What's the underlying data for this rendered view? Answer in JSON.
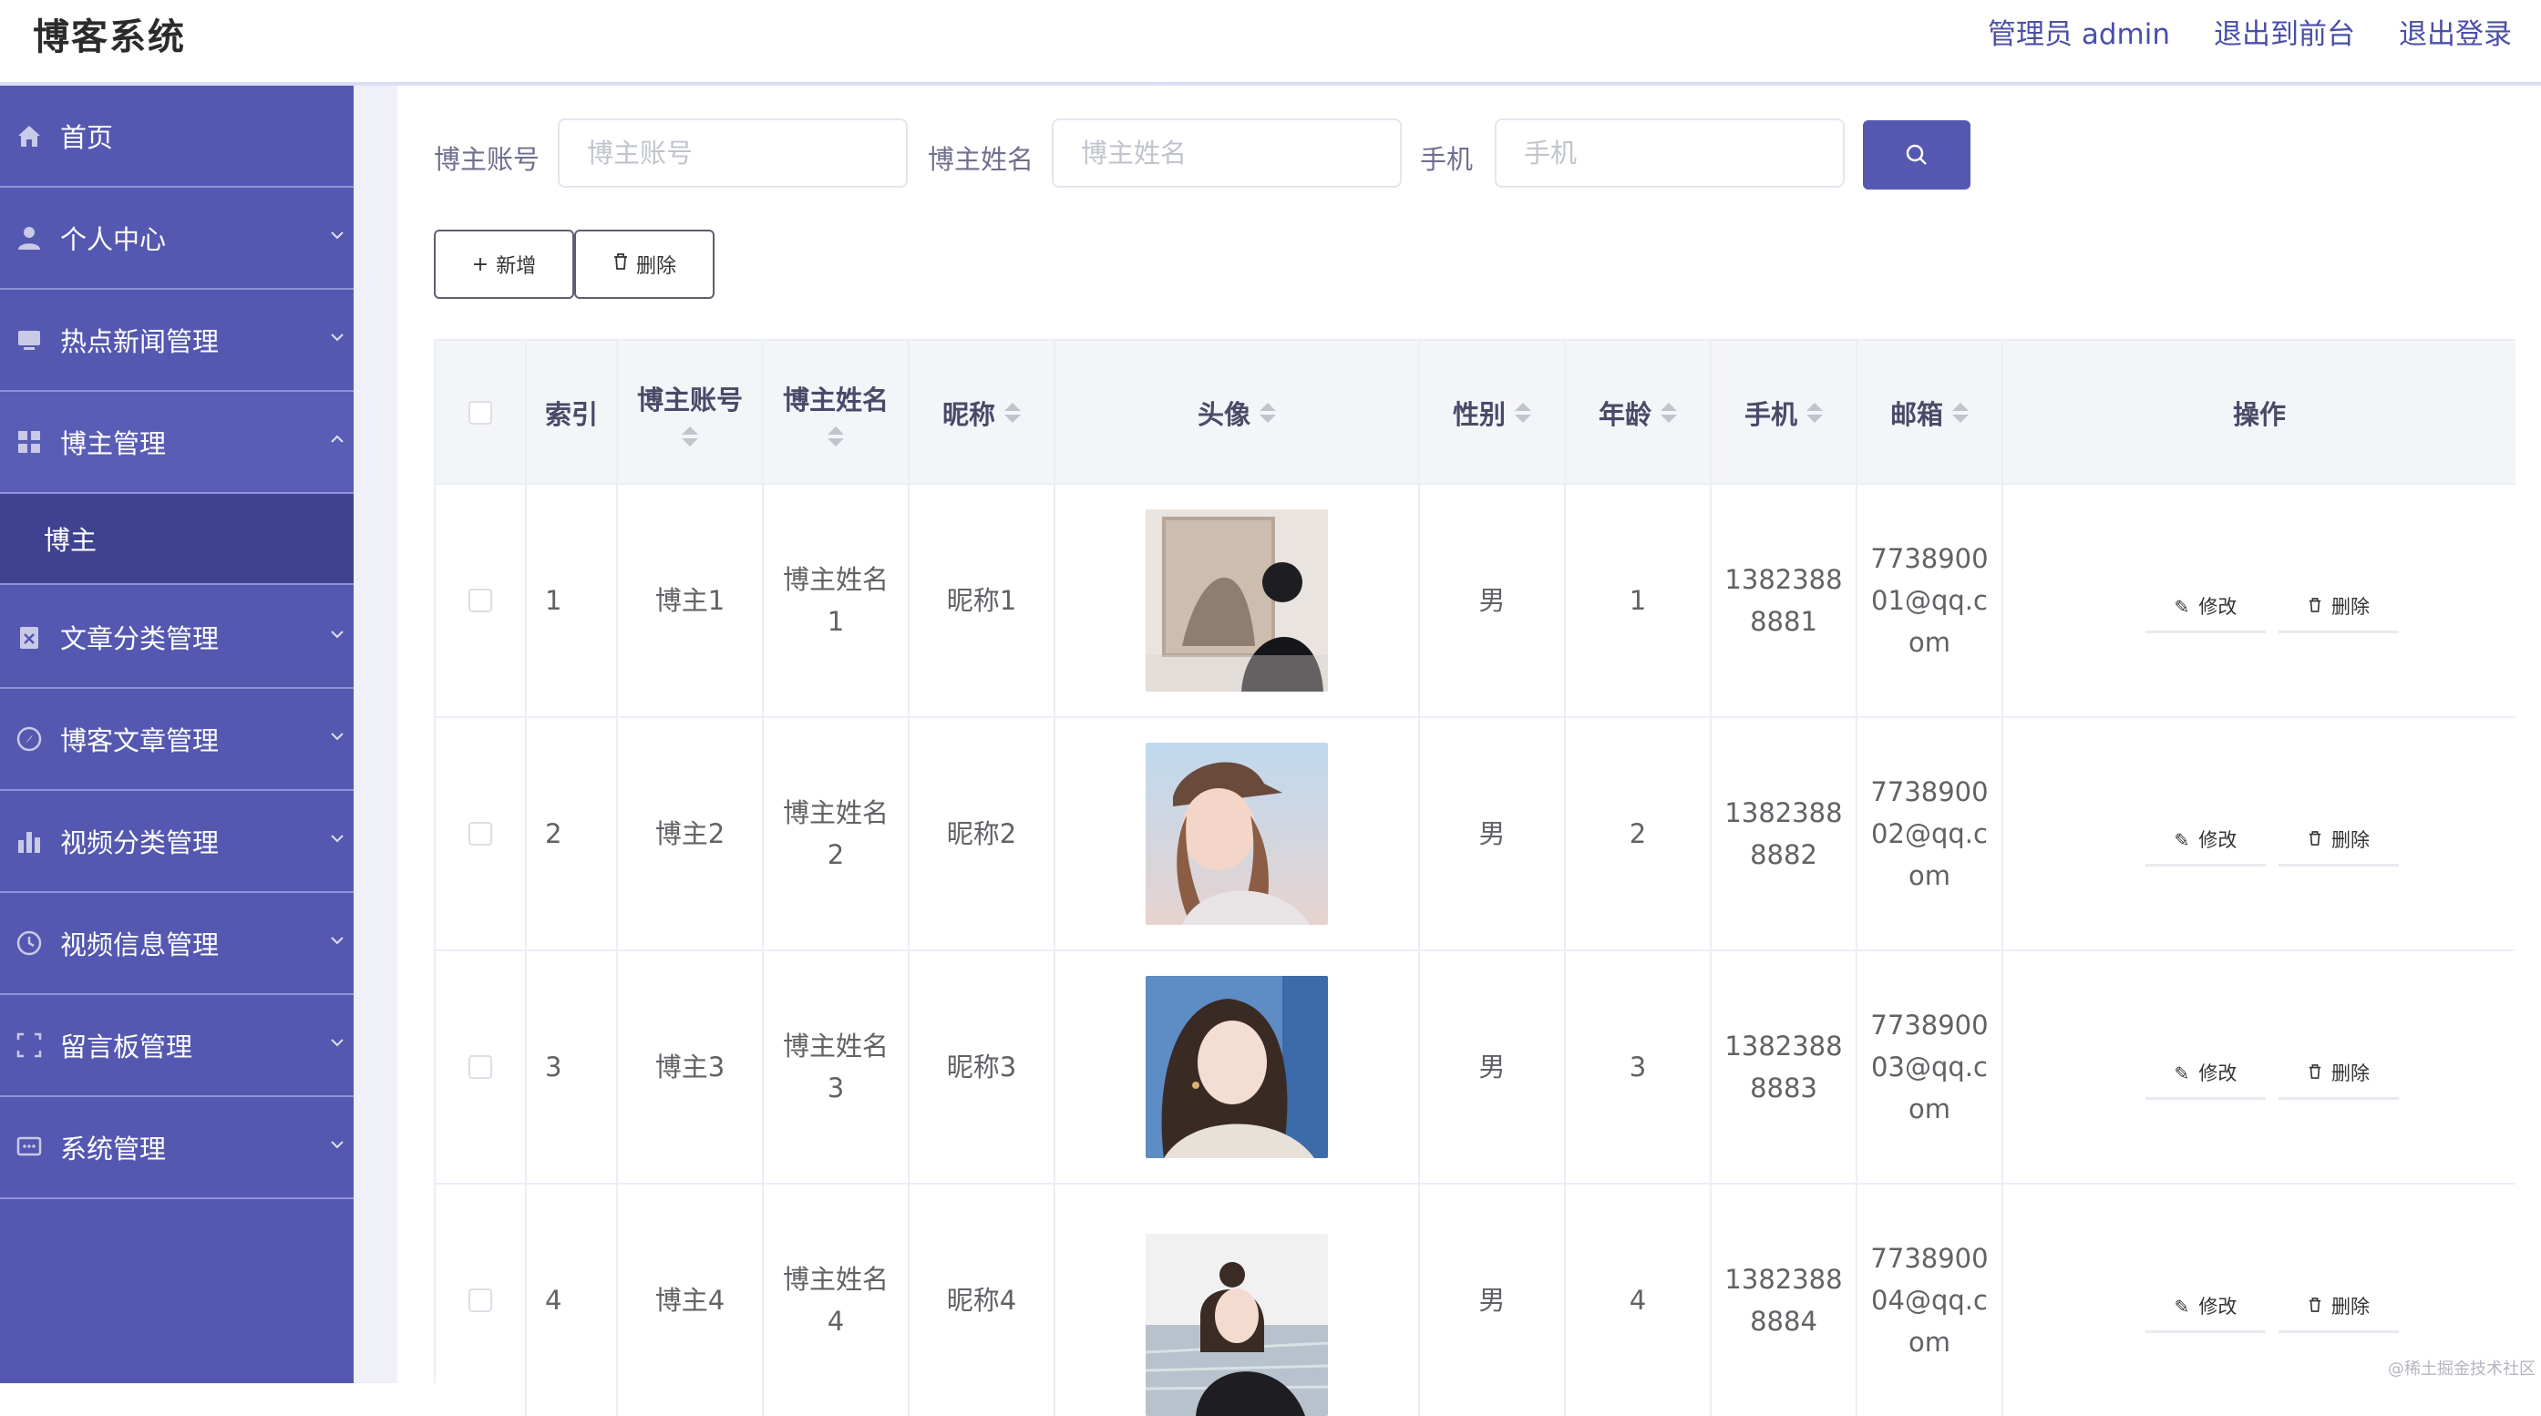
{
  "header": {
    "title": "博客系统",
    "links": [
      "管理员 admin",
      "退出到前台",
      "退出登录"
    ]
  },
  "sidebar": {
    "items": [
      {
        "label": "首页",
        "icon": "home-icon",
        "has_children": false
      },
      {
        "label": "个人中心",
        "icon": "user-icon",
        "has_children": true
      },
      {
        "label": "热点新闻管理",
        "icon": "monitor-icon",
        "has_children": true
      },
      {
        "label": "博主管理",
        "icon": "grid-icon",
        "has_children": true,
        "expanded": true
      },
      {
        "label": "文章分类管理",
        "icon": "clipboard-icon",
        "has_children": true
      },
      {
        "label": "博客文章管理",
        "icon": "compass-icon",
        "has_children": true
      },
      {
        "label": "视频分类管理",
        "icon": "bar-chart-icon",
        "has_children": true
      },
      {
        "label": "视频信息管理",
        "icon": "clock-icon",
        "has_children": true
      },
      {
        "label": "留言板管理",
        "icon": "frame-icon",
        "has_children": true
      },
      {
        "label": "系统管理",
        "icon": "message-icon",
        "has_children": true
      }
    ],
    "submenu": {
      "label": "博主"
    }
  },
  "search": {
    "fields": [
      {
        "label": "博主账号",
        "placeholder": "博主账号"
      },
      {
        "label": "博主姓名",
        "placeholder": "博主姓名"
      },
      {
        "label": "手机",
        "placeholder": "手机"
      }
    ],
    "button_icon": "search-icon"
  },
  "toolbar": {
    "add_label": "新增",
    "delete_label": "删除"
  },
  "table": {
    "columns": [
      "索引",
      "博主账号",
      "博主姓名",
      "昵称",
      "头像",
      "性别",
      "年龄",
      "手机",
      "邮箱",
      "操作"
    ],
    "rows": [
      {
        "index": "1",
        "account": "博主1",
        "name_lines": [
          "博主姓名",
          "1"
        ],
        "nickname": "昵称1",
        "gender": "男",
        "age": "1",
        "phone_lines": [
          "1382388",
          "8881"
        ],
        "email_lines": [
          "7738900",
          "01@qq.c",
          "om"
        ]
      },
      {
        "index": "2",
        "account": "博主2",
        "name_lines": [
          "博主姓名",
          "2"
        ],
        "nickname": "昵称2",
        "gender": "男",
        "age": "2",
        "phone_lines": [
          "1382388",
          "8882"
        ],
        "email_lines": [
          "7738900",
          "02@qq.c",
          "om"
        ]
      },
      {
        "index": "3",
        "account": "博主3",
        "name_lines": [
          "博主姓名",
          "3"
        ],
        "nickname": "昵称3",
        "gender": "男",
        "age": "3",
        "phone_lines": [
          "1382388",
          "8883"
        ],
        "email_lines": [
          "7738900",
          "03@qq.c",
          "om"
        ]
      },
      {
        "index": "4",
        "account": "博主4",
        "name_lines": [
          "博主姓名",
          "4"
        ],
        "nickname": "昵称4",
        "gender": "男",
        "age": "4",
        "phone_lines": [
          "1382388",
          "8884"
        ],
        "email_lines": [
          "7738900",
          "04@qq.c",
          "om"
        ]
      }
    ],
    "actions": {
      "edit_label": "修改",
      "delete_label": "删除"
    }
  },
  "watermark": "@稀土掘金技术社区",
  "colors": {
    "accent": "#5558b0",
    "submenu_active": "#3f4291"
  }
}
